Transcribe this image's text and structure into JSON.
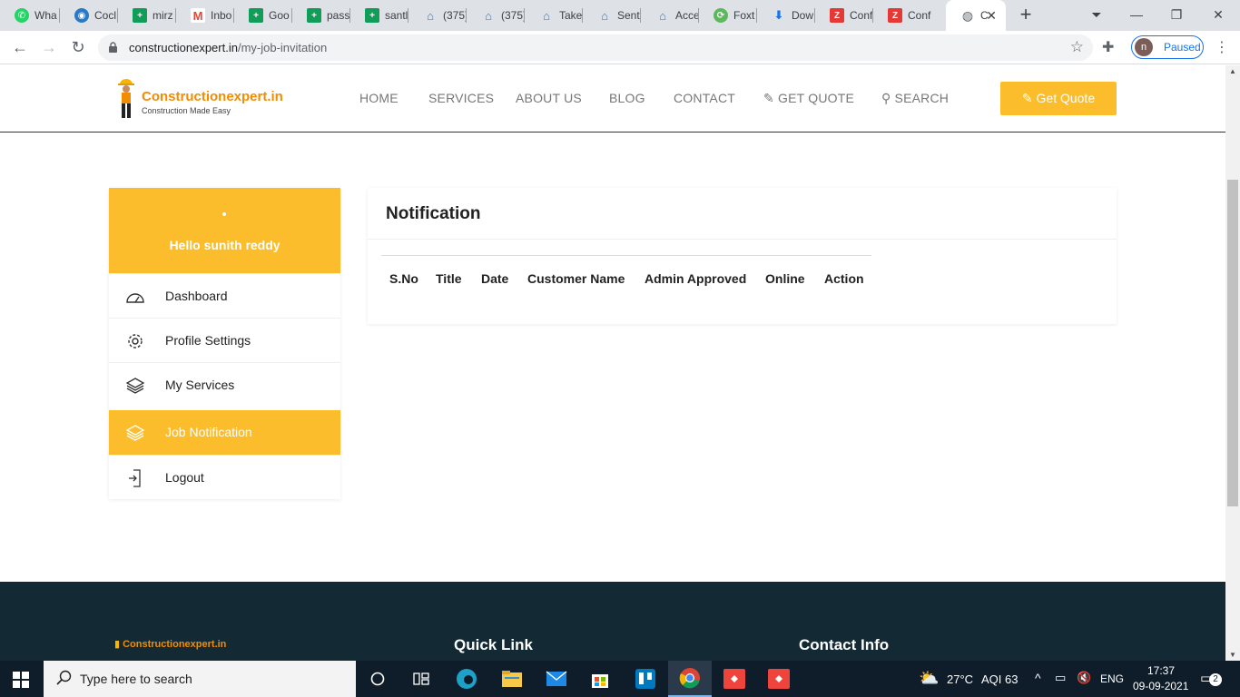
{
  "browser": {
    "tabs": [
      {
        "label": "Wha",
        "icon": "whatsapp-icon",
        "color": "#25d366"
      },
      {
        "label": "Cocl",
        "icon": "cocolog-icon",
        "color": "#2979c4"
      },
      {
        "label": "mirz",
        "icon": "sheets-icon",
        "color": "#0f9d58"
      },
      {
        "label": "Inbo",
        "icon": "gmail-icon",
        "color": "#ea4335"
      },
      {
        "label": "Goo",
        "icon": "sheets-icon",
        "color": "#0f9d58"
      },
      {
        "label": "pass",
        "icon": "sheets-icon",
        "color": "#0f9d58"
      },
      {
        "label": "santl",
        "icon": "sheets-icon",
        "color": "#0f9d58"
      },
      {
        "label": "(375)",
        "icon": "mail-icon",
        "color": "#3b78c4"
      },
      {
        "label": "(375)",
        "icon": "mail-icon",
        "color": "#3b78c4"
      },
      {
        "label": "Take",
        "icon": "mail-icon",
        "color": "#3b78c4"
      },
      {
        "label": "Sent",
        "icon": "mail-icon",
        "color": "#3b78c4"
      },
      {
        "label": "Acce",
        "icon": "mail-icon",
        "color": "#3b78c4"
      },
      {
        "label": "Foxt",
        "icon": "foxit-icon",
        "color": "#5cb85c"
      },
      {
        "label": "Dow",
        "icon": "download-icon",
        "color": "#1a73e8"
      },
      {
        "label": "Conf",
        "icon": "zoho-icon",
        "color": "#e53935"
      },
      {
        "label": "Conf",
        "icon": "zoho-icon",
        "color": "#e53935"
      },
      {
        "label": "C",
        "icon": "globe-icon",
        "color": "#5f6368"
      }
    ],
    "url_domain": "constructionexpert.in",
    "url_path": "/my-job-invitation",
    "profile_initial": "n",
    "profile_status": "Paused"
  },
  "site": {
    "brand": "Constructionexpert.in",
    "tagline": "Construction Made Easy",
    "nav": [
      "HOME",
      "SERVICES",
      "ABOUT US",
      "BLOG",
      "CONTACT",
      "GET QUOTE",
      "SEARCH"
    ],
    "cta": "Get Quote"
  },
  "sidebar": {
    "greeting": "Hello sunith reddy",
    "items": [
      {
        "label": "Dashboard",
        "icon": "dashboard-icon"
      },
      {
        "label": "Profile Settings",
        "icon": "gear-icon"
      },
      {
        "label": "My Services",
        "icon": "layers-icon"
      },
      {
        "label": "Job Notification",
        "icon": "layers-icon",
        "active": true
      },
      {
        "label": "Logout",
        "icon": "logout-icon"
      }
    ]
  },
  "main": {
    "title": "Notification",
    "columns": [
      "S.No",
      "Title",
      "Date",
      "Customer Name",
      "Admin Approved",
      "Online",
      "Action"
    ]
  },
  "footer": {
    "brand": "Constructionexpert.in",
    "quick_link": "Quick Link",
    "contact_info": "Contact Info"
  },
  "taskbar": {
    "search_placeholder": "Type here to search",
    "weather": "27°C",
    "aqi": "AQI 63",
    "lang": "ENG",
    "time": "17:37",
    "date": "09-09-2021",
    "notifications": "2"
  },
  "colors": {
    "accent": "#fbbd2c",
    "brand_orange": "#f28c00",
    "footer_bg": "#132a35"
  }
}
